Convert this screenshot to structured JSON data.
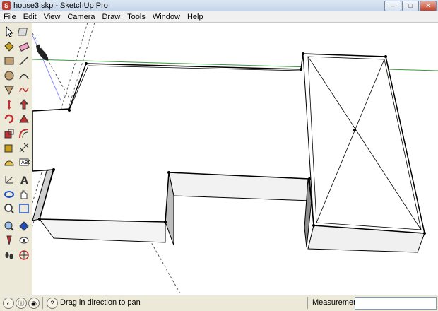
{
  "window": {
    "title": "house3.skp - SketchUp Pro",
    "controls": [
      "–",
      "□",
      "✕"
    ]
  },
  "menu": [
    "File",
    "Edit",
    "View",
    "Camera",
    "Draw",
    "Tools",
    "Window",
    "Help"
  ],
  "tools": [
    {
      "name": "select-tool-icon"
    },
    {
      "name": "make-component-icon"
    },
    {
      "name": "paint-bucket-icon"
    },
    {
      "name": "eraser-icon"
    },
    {
      "name": "rectangle-icon"
    },
    {
      "name": "line-icon"
    },
    {
      "name": "circle-icon"
    },
    {
      "name": "arc-icon"
    },
    {
      "name": "polygon-icon"
    },
    {
      "name": "freehand-icon"
    },
    {
      "name": "move-icon"
    },
    {
      "name": "push-pull-icon"
    },
    {
      "name": "rotate-icon"
    },
    {
      "name": "follow-me-icon"
    },
    {
      "name": "scale-icon"
    },
    {
      "name": "offset-icon"
    },
    {
      "name": "tape-measure-icon"
    },
    {
      "name": "dimension-icon"
    },
    {
      "name": "protractor-icon"
    },
    {
      "name": "text-icon"
    },
    {
      "name": "axes-icon"
    },
    {
      "name": "3d-text-icon"
    },
    {
      "name": "orbit-icon"
    },
    {
      "name": "pan-icon"
    },
    {
      "name": "zoom-icon"
    },
    {
      "name": "zoom-window-icon"
    },
    {
      "name": "zoom-extents-icon"
    },
    {
      "name": "previous-view-icon"
    },
    {
      "name": "position-camera-icon"
    },
    {
      "name": "look-around-icon"
    },
    {
      "name": "walk-icon"
    },
    {
      "name": "section-plane-icon"
    }
  ],
  "status": {
    "hint": "Drag in direction to pan",
    "measurements_label": "Measurements",
    "measurements_value": "",
    "help_icon": "?"
  },
  "colors": {
    "green_axis": "#3c9a3c",
    "red_axis": "#c83232",
    "blue_axis": "#3232c8"
  }
}
